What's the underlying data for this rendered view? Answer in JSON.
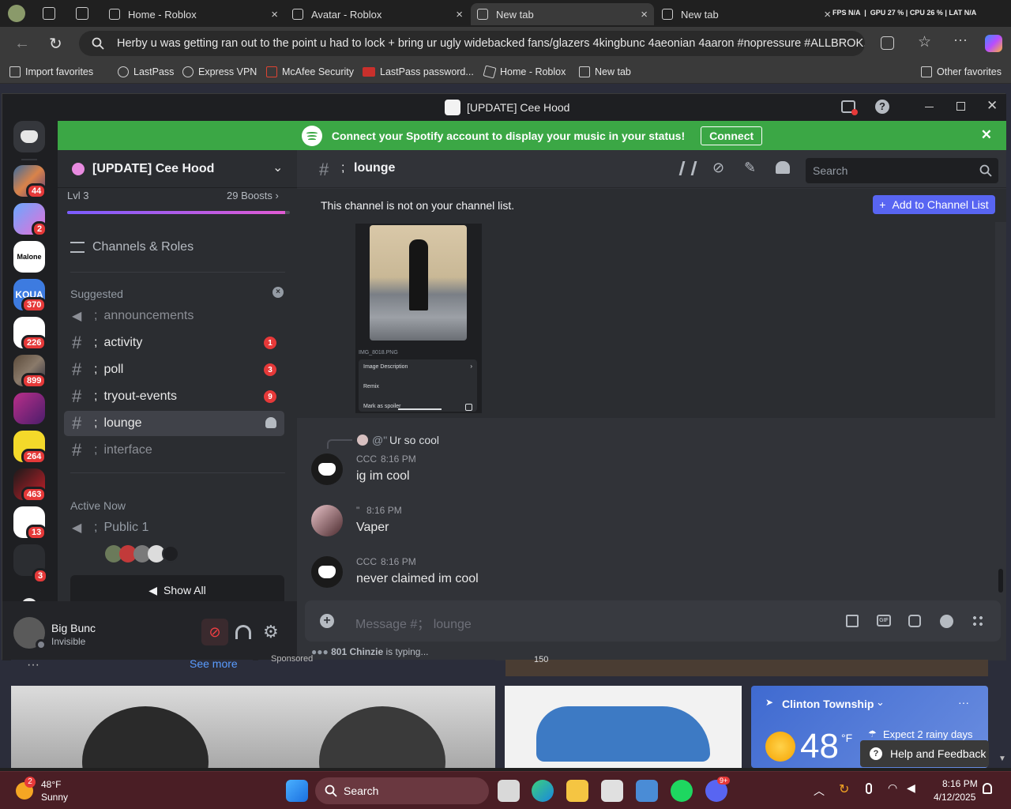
{
  "browser": {
    "tabs": [
      {
        "label": "Home - Roblox"
      },
      {
        "label": "Avatar - Roblox"
      },
      {
        "label": "New tab"
      },
      {
        "label": "New tab"
      }
    ],
    "stats": {
      "fps": "FPS",
      "fps_val": "N/A",
      "gpu": "GPU",
      "gpu_val": "27 %",
      "cpu": "CPU",
      "cpu_val": "26 %",
      "lat": "LAT",
      "lat_val": "N/A"
    },
    "address": "Herby u was getting ran out to the point u had to lock + bring ur ugly widebacked fans/glazers 4kingbunc 4aeonian 4aaron #nopressure #ALLBROK...",
    "bookmarks": [
      "Import favorites",
      "LastPass",
      "Express VPN",
      "McAfee Security",
      "LastPass password...",
      "Home - Roblox",
      "New tab"
    ],
    "other_favorites": "Other favorites"
  },
  "discord": {
    "window_title": "[UPDATE] Cee Hood",
    "spotify_banner": {
      "text": "Connect your Spotify account to display your music in your status!",
      "button": "Connect"
    },
    "servers": [
      {
        "badge": "44"
      },
      {
        "badge": "2"
      },
      {
        "label": "Malone"
      },
      {
        "badge": "370",
        "label": "KOUA"
      },
      {
        "badge": "226"
      },
      {
        "badge": "899"
      },
      {
        "label": ""
      },
      {
        "badge": "264"
      },
      {
        "badge": "463"
      },
      {
        "badge": "13"
      },
      {
        "badge": "3"
      }
    ],
    "server": {
      "name": "[UPDATE] Cee Hood",
      "level": "Lvl 3",
      "boosts": "29 Boosts",
      "boost_progress": 0.98,
      "channels_roles": "Channels & Roles",
      "suggested_label": "Suggested",
      "channels": [
        {
          "name": "announcements",
          "sep": ";",
          "badge": ""
        },
        {
          "name": "activity",
          "sep": ";",
          "badge": "1"
        },
        {
          "name": "poll",
          "sep": ";",
          "badge": "3"
        },
        {
          "name": "tryout-events",
          "sep": ";",
          "badge": "9"
        },
        {
          "name": "lounge",
          "sep": ";",
          "badge": ""
        },
        {
          "name": "interface",
          "sep": ";",
          "badge": ""
        }
      ],
      "active_now": "Active Now",
      "voice_channel": "Public 1",
      "voice_sep": ";",
      "show_all": "Show All"
    },
    "user": {
      "name": "Big Bunc",
      "status": "Invisible"
    },
    "chat": {
      "channel": "lounge",
      "channel_sep": ";",
      "search_placeholder": "Search",
      "notice": "This channel is not on your channel list.",
      "add_button": "Add to Channel List",
      "image_filename": "IMG_8018.PNG",
      "image_menu": [
        "Image Description",
        "Remix",
        "Mark as spoiler"
      ],
      "reply_preview": {
        "user": "@\"",
        "text": "Ur so cool"
      },
      "messages": [
        {
          "author": "CCC",
          "time": "8:16 PM",
          "text": "ig im cool"
        },
        {
          "author": "\"",
          "time": "8:16 PM",
          "text": "Vaper"
        },
        {
          "author": "CCC",
          "time": "8:16 PM",
          "text": "never claimed im cool"
        }
      ],
      "composer_placeholder": "Message #； lounge",
      "typing_user": "801 Chinzie",
      "typing_suffix": " is typing..."
    }
  },
  "page": {
    "see_more": "See more",
    "sponsored": "Sponsored",
    "likes": "150",
    "weather_location": "Clinton Township",
    "weather_temp": "48",
    "weather_unit": "°F",
    "weather_note": "Expect 2 rainy days",
    "help_feedback": "Help and Feedback"
  },
  "taskbar": {
    "weather_temp": "48°F",
    "weather_cond": "Sunny",
    "weather_badge": "2",
    "search": "Search",
    "discord_badge": "9+",
    "time": "8:16 PM",
    "date": "4/12/2025"
  }
}
